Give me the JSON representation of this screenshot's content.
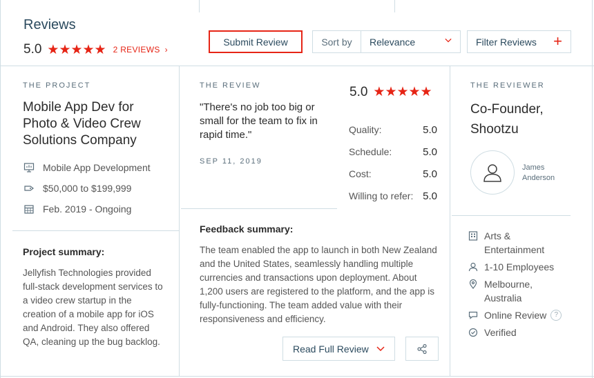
{
  "header": {
    "title": "Reviews",
    "score": "5.0",
    "stars": "★★★★★",
    "reviews_link": "2 REVIEWS",
    "reviews_chevron": "›",
    "submit_label": "Submit Review",
    "sort_label": "Sort by",
    "sort_value": "Relevance",
    "filter_label": "Filter Reviews",
    "filter_plus": "+"
  },
  "project": {
    "kicker": "THE PROJECT",
    "title": "Mobile App Dev for Photo & Video Crew Solutions Company",
    "service": "Mobile App Development",
    "budget": "$50,000 to $199,999",
    "timeline": "Feb. 2019 - Ongoing",
    "summary_heading": "Project summary:",
    "summary_text": "Jellyfish Technologies provided full-stack development services to a video crew startup in the creation of a mobile app for iOS and Android. They also offered QA, cleaning up the bug backlog."
  },
  "review": {
    "kicker": "THE REVIEW",
    "quote": "\"There's no job too big or small for the team to fix in rapid time.\"",
    "date": "SEP 11, 2019",
    "score": "5.0",
    "stars": "★★★★★",
    "scores": [
      {
        "label": "Quality:",
        "value": "5.0"
      },
      {
        "label": "Schedule:",
        "value": "5.0"
      },
      {
        "label": "Cost:",
        "value": "5.0"
      },
      {
        "label": "Willing to refer:",
        "value": "5.0"
      }
    ],
    "feedback_heading": "Feedback summary:",
    "feedback_text": "The team enabled the app to launch in both New Zealand and the United States, seamlessly handling multiple currencies and transactions upon deployment. About 1,200 users are registered to the platform, and the app is fully-functioning. The team added value with their responsiveness and efficiency.",
    "read_full_label": "Read Full Review"
  },
  "reviewer": {
    "kicker": "THE REVIEWER",
    "title": "Co-Founder, Shootzu",
    "name": "James Anderson",
    "industry": "Arts & Entertainment",
    "size": "1-10 Employees",
    "location": "Melbourne, Australia",
    "review_type": "Online Review",
    "help_mark": "?",
    "status": "Verified"
  },
  "colors": {
    "accent": "#e62415",
    "border": "#cfdde3",
    "heading": "#2b4a5e"
  }
}
